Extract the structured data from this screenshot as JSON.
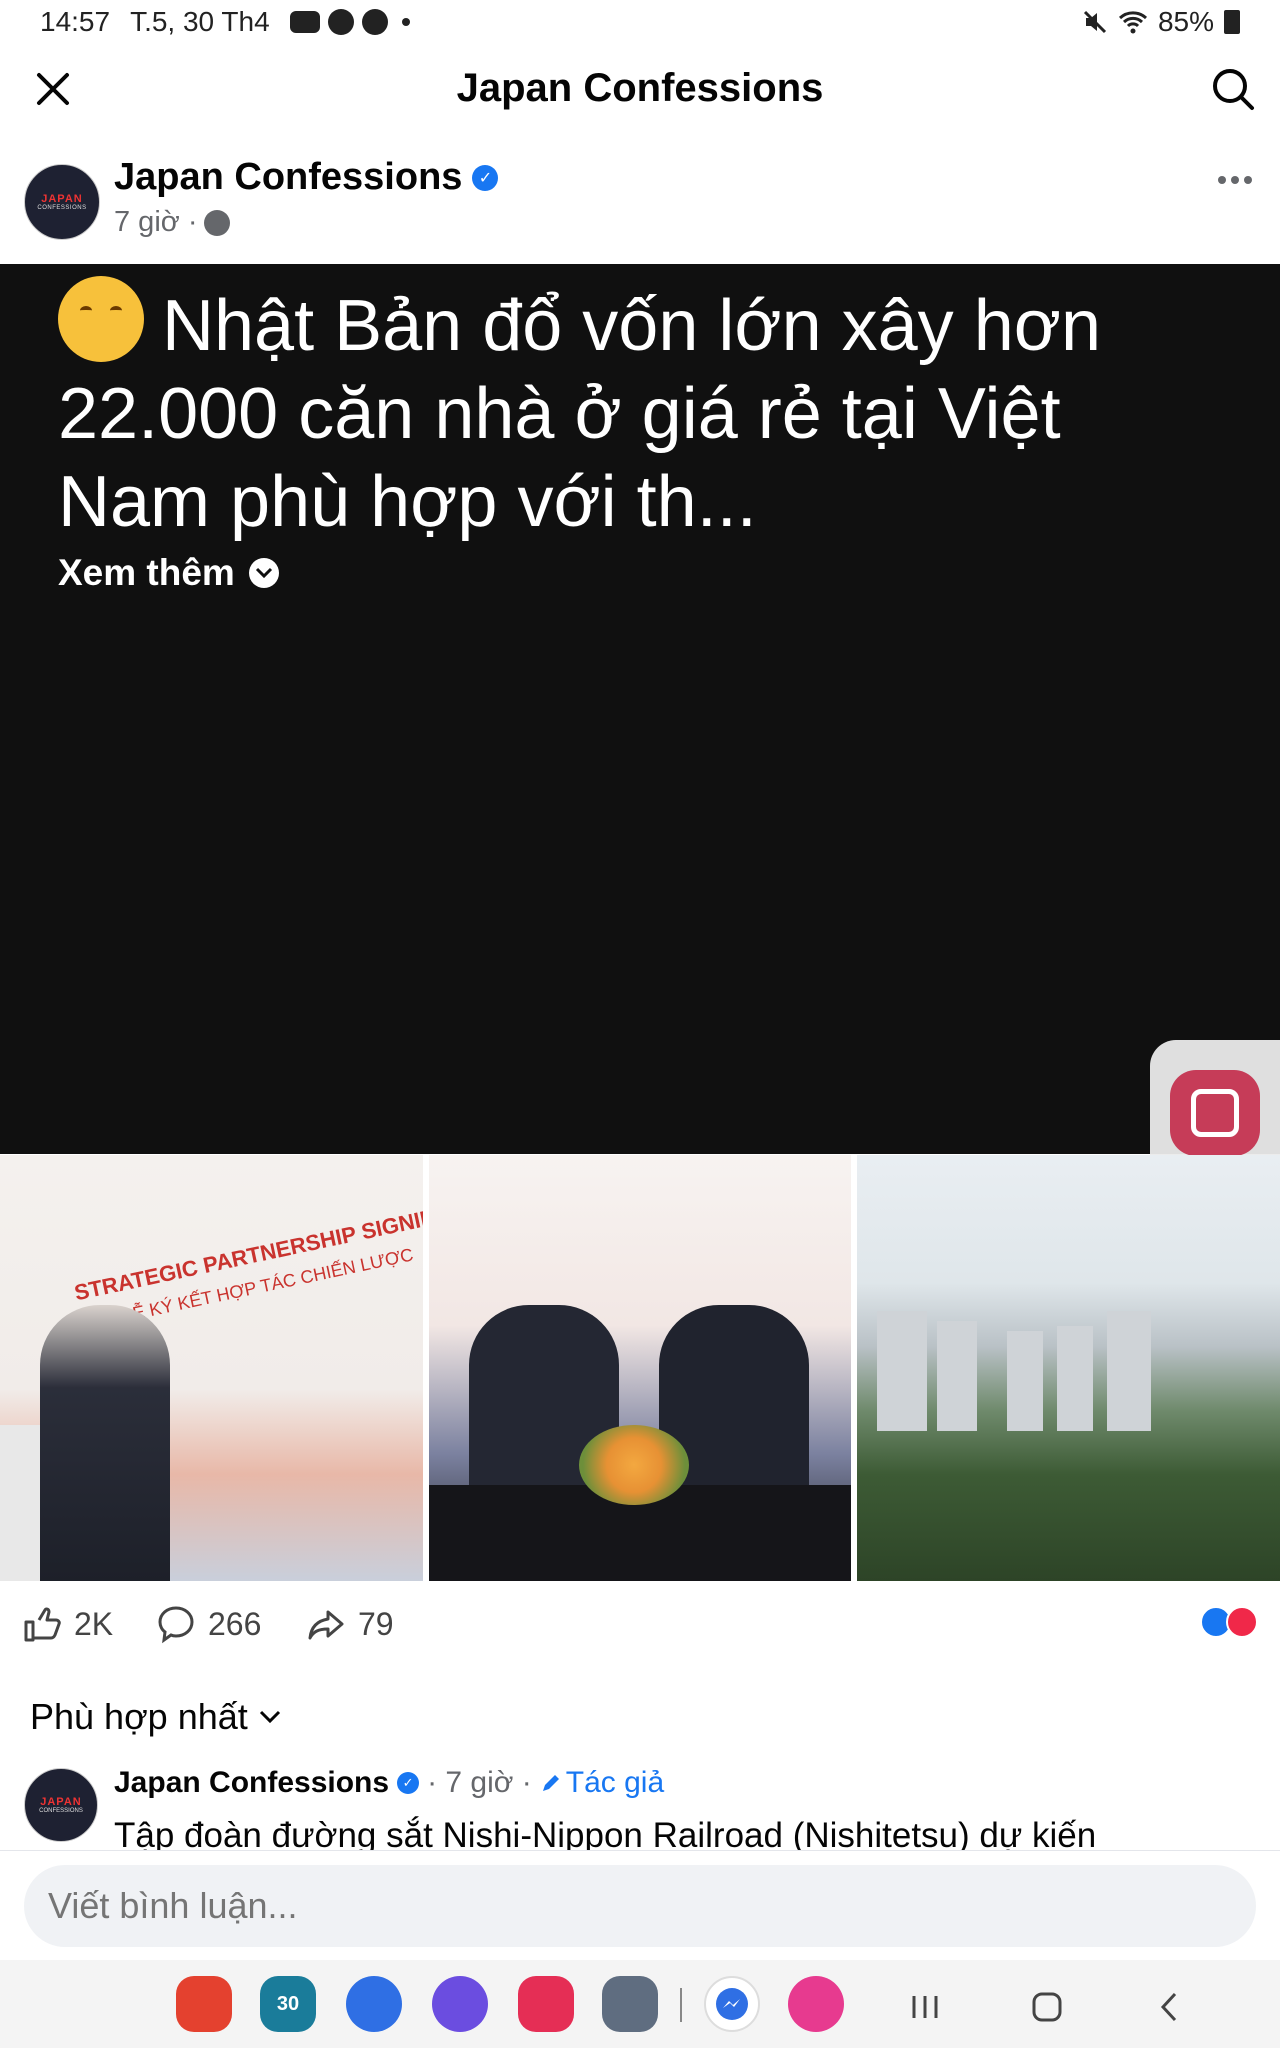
{
  "status_bar": {
    "time": "14:57",
    "date": "T.5, 30 Th4",
    "battery": "85%"
  },
  "header": {
    "title": "Japan Confessions"
  },
  "post": {
    "author": "Japan Confessions",
    "time": "7 giờ ·",
    "text": "Nhật Bản đổ vốn lớn xây hơn 22.000 căn nhà ở giá rẻ tại Việt Nam phù hợp với th...",
    "see_more": "Xem thêm",
    "avatar_text_top": "JAPAN",
    "avatar_text_bottom": "CONFESSIONS"
  },
  "photos": {
    "photo1_title": "STRATEGIC PARTNERSHIP SIGNING CER",
    "photo1_subtitle": "LỄ KÝ KẾT HỢP TÁC CHIẾN LƯỢC"
  },
  "actions": {
    "likes": "2K",
    "comments": "266",
    "shares": "79"
  },
  "comments_section": {
    "sort_label": "Phù hợp nhất",
    "first_comment": {
      "author": "Japan Confessions",
      "time": "· 7 giờ ·",
      "badge": "Tác giả",
      "text": "Tập đoàn đường sắt Nishi-Nippon Railroad (Nishitetsu) dự kiến"
    },
    "composer_placeholder": "Viết bình luận..."
  },
  "dock": {
    "calendar_day": "30"
  }
}
